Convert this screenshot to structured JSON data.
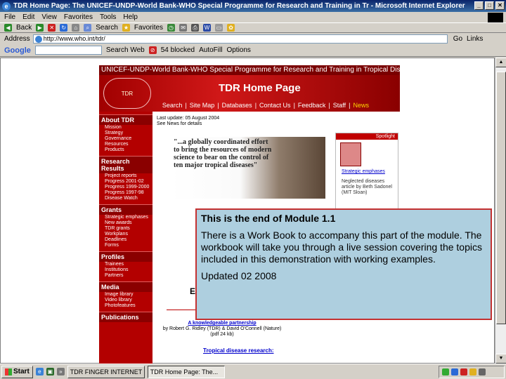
{
  "window": {
    "title": "TDR Home Page: The UNICEF-UNDP-World Bank-WHO Special Programme for Research and Training in Tr - Microsoft Internet Explorer"
  },
  "menu": [
    "File",
    "Edit",
    "View",
    "Favorites",
    "Tools",
    "Help"
  ],
  "toolbar": {
    "back": "Back",
    "search": "Search",
    "favorites": "Favorites"
  },
  "address": {
    "label": "Address",
    "url": "http://www.who.int/tdr/",
    "go": "Go",
    "links": "Links"
  },
  "googlebar": {
    "logo": "Google",
    "search_web": "Search Web",
    "blocked": "54 blocked",
    "autofill": "AutoFill",
    "options": "Options"
  },
  "tdr": {
    "banner": "UNICEF-UNDP-World Bank-WHO Special Programme for Research and Training in Tropical Diseases",
    "title": "TDR Home Page",
    "logo": "TDR",
    "nav": [
      "Search",
      "Site Map",
      "Databases",
      "Contact Us",
      "Feedback",
      "Staff",
      "News"
    ],
    "last_update": "Last update: 05 August 2004",
    "see_news": "See News for details",
    "quote": "\"...a globally coordinated effort to bring the resources of modern science to bear on the control of ten major tropical diseases\"",
    "sidebar": [
      {
        "heading": "About TDR",
        "items": [
          "Mission",
          "Strategy",
          "Governance",
          "Resources",
          "Products"
        ]
      },
      {
        "heading": "Research Results",
        "items": [
          "Project reports",
          "Progress 2001-02",
          "Progress 1999-2000",
          "Progress 1997-98",
          "Disease Watch"
        ]
      },
      {
        "heading": "Grants",
        "items": [
          "Strategic emphases",
          "New awards",
          "TDR grants",
          "Workplans",
          "Deadlines",
          "Forms"
        ]
      },
      {
        "heading": "Profiles",
        "items": [
          "Trainees",
          "Institutions",
          "Partners"
        ]
      },
      {
        "heading": "Media",
        "items": [
          "Image library",
          "Video library",
          "Photofeatures"
        ]
      },
      {
        "heading": "Publications",
        "items": []
      }
    ],
    "spotlight": {
      "header": "Spotlight",
      "link1": "Strategic emphases",
      "text2": "Neglected diseases article by Beth Sadonel (MIT Sloan)"
    },
    "partner_link": "A knowledgeable partnership",
    "partner_by": "by Robert G. Ridley (TDR) & David O'Connell (Nature)",
    "partner_pdf": "(pdf 24 kb)",
    "tropical": "Tropical disease research:",
    "e_char": "E"
  },
  "overlay": {
    "heading": "This is the end of Module 1.1",
    "body": "There is a Work Book to accompany this part of the module. The workbook will take you through a live session covering the topics included in this demonstration with working examples.",
    "footer": "Updated 02 2008"
  },
  "taskbar": {
    "start": "Start",
    "tasks": [
      "TDR FINGER INTERNET C...",
      "TDR Home Page: The..."
    ]
  }
}
